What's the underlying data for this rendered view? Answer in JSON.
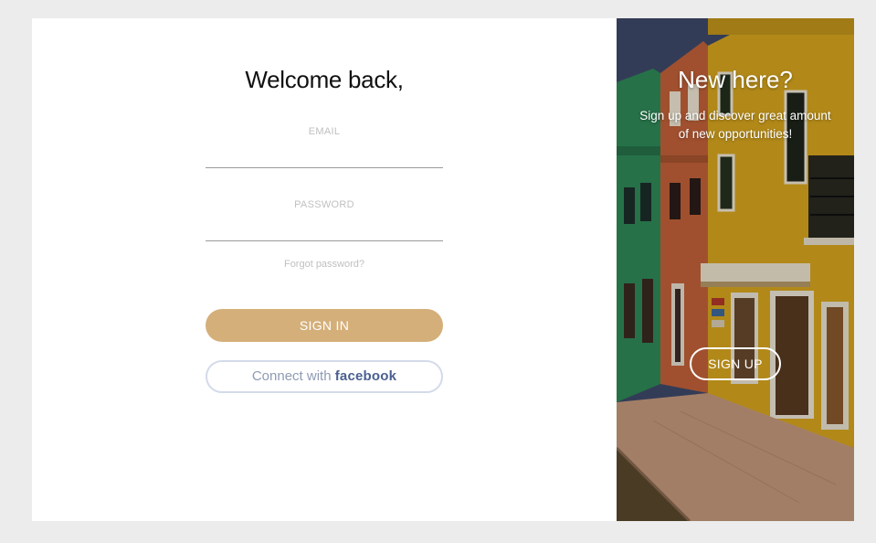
{
  "signin": {
    "title": "Welcome back,",
    "email_label": "EMAIL",
    "email_value": "",
    "password_label": "PASSWORD",
    "password_value": "",
    "forgot_link": "Forgot password?",
    "signin_button": "SIGN IN",
    "facebook_prefix": "Connect with ",
    "facebook_brand": "facebook"
  },
  "signup": {
    "title": "New here?",
    "description": "Sign up and discover great amount of new opportunities!",
    "signup_button": "SIGN UP",
    "image_icon": "colorful-houses-street-photo"
  },
  "colors": {
    "accent": "#d4af7a",
    "facebook_text": "#4b6090",
    "facebook_border": "#d3dae9",
    "page_background": "#ececec",
    "label_gray": "#c0c0c0"
  }
}
